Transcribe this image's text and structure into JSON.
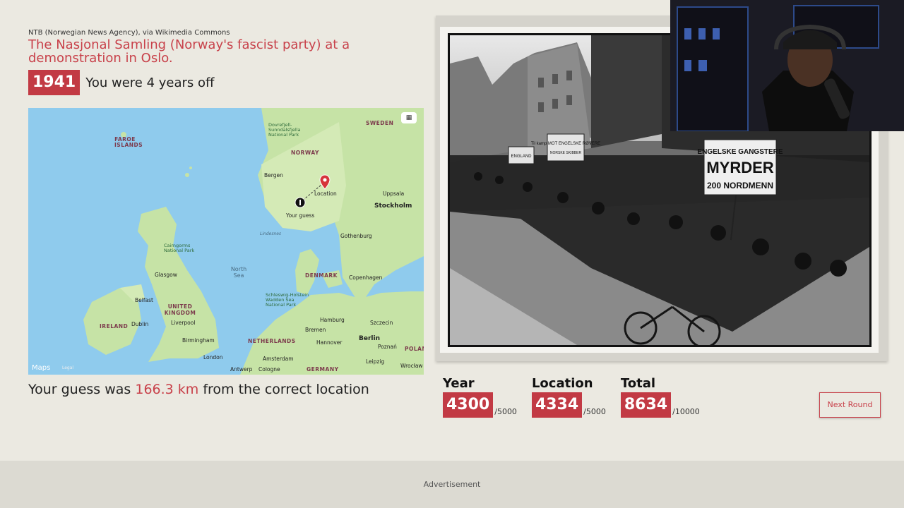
{
  "photo": {
    "credit": "NTB (Norwegian News Agency), via Wikimedia Commons",
    "title": "The Nasjonal Samling (Norway's fascist party) at a demonstration in Oslo.",
    "year": "1941",
    "year_diff_text": "You were 4 years off",
    "signs": [
      "ENGELSKE GANGSTERE",
      "MYRDER",
      "200 NORDMENN",
      "Til kamp MOT ENGELSKE RØVERE",
      "NORSKE SKIBBER",
      "ENGLAND"
    ]
  },
  "map": {
    "toggle_icon": "map-icon",
    "brand": "Maps",
    "legal": "Legal",
    "labels": {
      "sweden": "SWEDEN",
      "norway": "NORWAY",
      "faroe": "FAROE ISLANDS",
      "dovrefjell": "Dovrefjell-Sunndalsfjella National Park",
      "bergen": "Bergen",
      "location": "Location",
      "your_guess": "Your guess",
      "uppsala": "Uppsala",
      "stockholm": "Stockholm",
      "lindesnes": "Lindesnes",
      "gothenburg": "Gothenburg",
      "cairngorms": "Cairngorms National Park",
      "north_sea": "North Sea",
      "denmark": "DENMARK",
      "copenhagen": "Copenhagen",
      "glasgow": "Glasgow",
      "united_kingdom": "UNITED KINGDOM",
      "schleswig": "Schleswig-Holstein Wadden Sea National Park",
      "belfast": "Belfast",
      "ireland": "IRELAND",
      "dublin": "Dublin",
      "liverpool": "Liverpool",
      "hamburg": "Hamburg",
      "szczecin": "Szczecin",
      "bremen": "Bremen",
      "birmingham": "Birmingham",
      "netherlands": "NETHERLANDS",
      "hannover": "Hannover",
      "berlin": "Berlin",
      "poznan": "Poznań",
      "london": "London",
      "amsterdam": "Amsterdam",
      "antwerp": "Antwerp",
      "cologne": "Cologne",
      "germany": "GERMANY",
      "leipzig": "Leipzig",
      "wroclaw": "Wrocław",
      "poland": "POLAN"
    }
  },
  "result": {
    "prefix": "Your guess was ",
    "distance": "166.3 km",
    "suffix": " from the correct location"
  },
  "scores": {
    "year": {
      "label": "Year",
      "value": "4300",
      "max": "/5000"
    },
    "location": {
      "label": "Location",
      "value": "4334",
      "max": "/5000"
    },
    "total": {
      "label": "Total",
      "value": "8634",
      "max": "/10000"
    }
  },
  "next_button": "Next Round",
  "ad": "Advertisement",
  "colors": {
    "accent": "#c23a44",
    "background": "#ebe9e1",
    "sea": "#8fcbed",
    "land": "#c6e3a6"
  }
}
